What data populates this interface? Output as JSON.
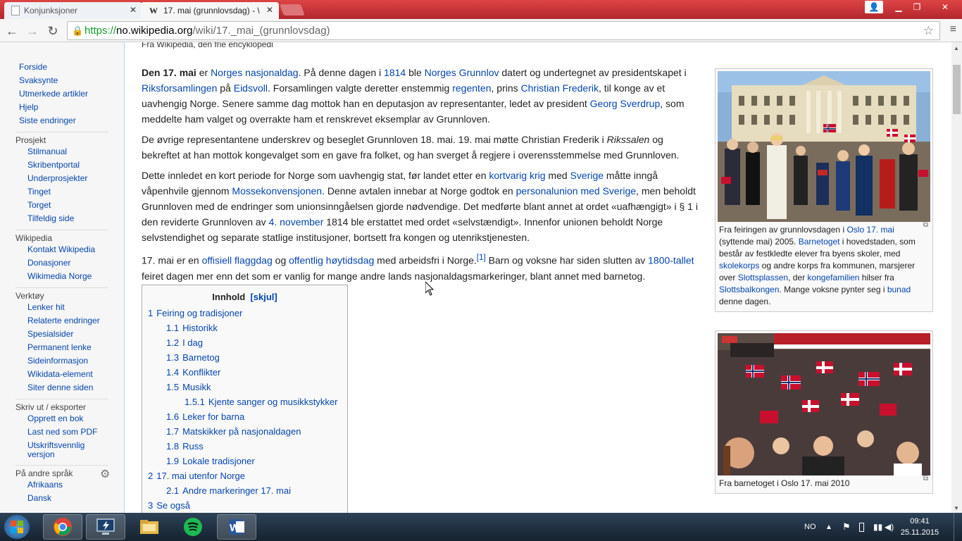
{
  "browser": {
    "tabs": [
      {
        "label": "Konjunksjoner",
        "icon": "page-icon"
      },
      {
        "label": "17. mai (grunnlovsdag) - \\",
        "icon": "wikipedia-icon"
      }
    ],
    "url": {
      "scheme": "https://",
      "domain": "no.wikipedia.org",
      "path": "/wiki/17._mai_(grunnlovsdag)"
    }
  },
  "sidebar": {
    "main": [
      "Forside",
      "Svaksynte",
      "Utmerkede artikler",
      "Hjelp",
      "Siste endringer"
    ],
    "prosjekt_title": "Prosjekt",
    "prosjekt": [
      "Stilmanual",
      "Skribentportal",
      "Underprosjekter",
      "Tinget",
      "Torget",
      "Tilfeldig side"
    ],
    "wikipedia_title": "Wikipedia",
    "wikipedia": [
      "Kontakt Wikipedia",
      "Donasjoner",
      "Wikimedia Norge"
    ],
    "verktoy_title": "Verktøy",
    "verktoy": [
      "Lenker hit",
      "Relaterte endringer",
      "Spesialsider",
      "Permanent lenke",
      "Sideinformasjon",
      "Wikidata-element",
      "Siter denne siden"
    ],
    "skriv_title": "Skriv ut / eksporter",
    "skriv": [
      "Opprett en bok",
      "Last ned som PDF",
      "Utskriftsvennlig versjon"
    ],
    "sprak_title": "På andre språk",
    "sprak": [
      "Afrikaans",
      "Dansk"
    ]
  },
  "article": {
    "from": "Fra Wikipedia, den frie encyklopedi",
    "toc_title": "Innhold",
    "toc_toggle": "[skjul]",
    "toc": [
      {
        "num": "1",
        "label": "Feiring og tradisjoner",
        "level": 1
      },
      {
        "num": "1.1",
        "label": "Historikk",
        "level": 2
      },
      {
        "num": "1.2",
        "label": "I dag",
        "level": 2
      },
      {
        "num": "1.3",
        "label": "Barnetog",
        "level": 2
      },
      {
        "num": "1.4",
        "label": "Konflikter",
        "level": 2
      },
      {
        "num": "1.5",
        "label": "Musikk",
        "level": 2
      },
      {
        "num": "1.5.1",
        "label": "Kjente sanger og musikkstykker",
        "level": 3
      },
      {
        "num": "1.6",
        "label": "Leker for barna",
        "level": 2
      },
      {
        "num": "1.7",
        "label": "Matskikker på nasjonaldagen",
        "level": 2
      },
      {
        "num": "1.8",
        "label": "Russ",
        "level": 2
      },
      {
        "num": "1.9",
        "label": "Lokale tradisjoner",
        "level": 2
      },
      {
        "num": "2",
        "label": "17. mai utenfor Norge",
        "level": 1
      },
      {
        "num": "2.1",
        "label": "Andre markeringer 17. mai",
        "level": 2
      },
      {
        "num": "3",
        "label": "Se også",
        "level": 1
      }
    ],
    "img2_caption": "Fra barnetoget i Oslo 17. mai 2010"
  },
  "taskbar": {
    "lang": "NO",
    "time": "09:41",
    "date": "25.11.2015",
    "apps": [
      "chrome-icon",
      "remote-desktop-icon",
      "file-explorer-icon",
      "spotify-icon",
      "word-icon"
    ]
  }
}
